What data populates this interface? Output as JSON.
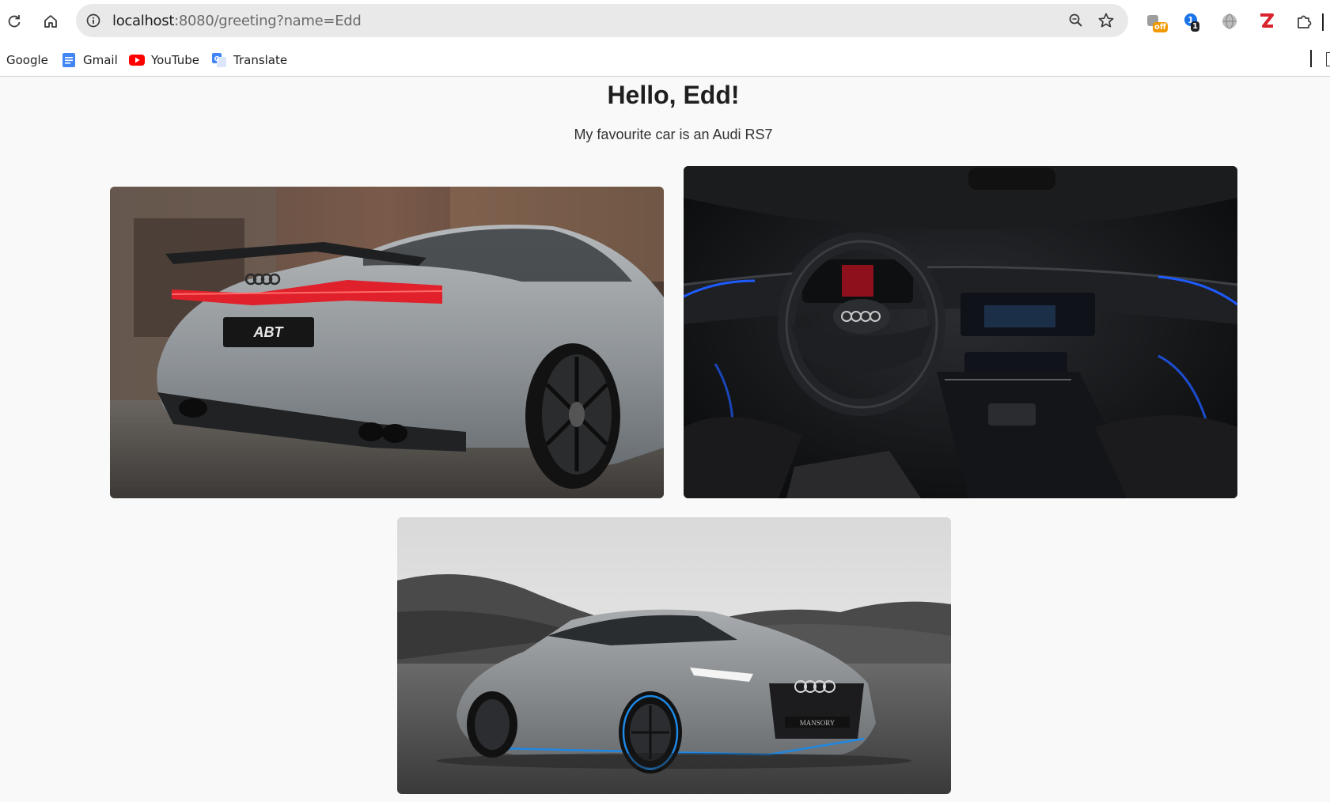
{
  "browser": {
    "url_host": "localhost",
    "url_path": ":8080/greeting?name=Edd",
    "extensions": [
      {
        "name": "off-extension",
        "badge": "off",
        "badge_color": "#f29900"
      },
      {
        "name": "one-extension",
        "badge": "1",
        "badge_color": "#202124"
      }
    ]
  },
  "bookmarks": [
    {
      "label": "Google"
    },
    {
      "label": "Gmail"
    },
    {
      "label": "YouTube"
    },
    {
      "label": "Translate"
    }
  ],
  "page": {
    "title": "Hello, Edd!",
    "subtitle": "My favourite car is an Audi RS7",
    "images": [
      {
        "name": "rear-view-photo",
        "logo": "ABT"
      },
      {
        "name": "interior-photo",
        "logo": ""
      },
      {
        "name": "front-view-photo",
        "logo": "MANSORY"
      }
    ]
  },
  "colors": {
    "page_background": "#f9f9f9",
    "omnibox": "#e9e9ea",
    "taillight_red": "#e0202a",
    "ambient_blue": "#1e5bff"
  }
}
